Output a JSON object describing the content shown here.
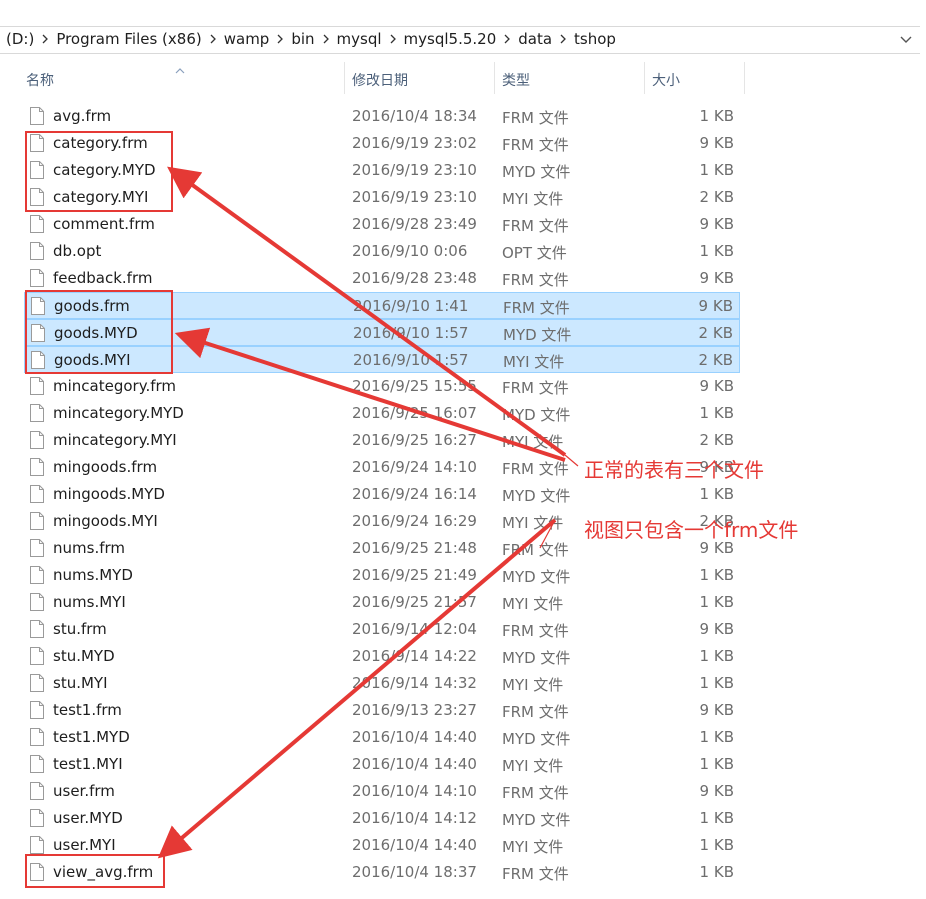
{
  "address_bar": {
    "crumbs": [
      "(D:)",
      "Program Files (x86)",
      "wamp",
      "bin",
      "mysql",
      "mysql5.5.20",
      "data",
      "tshop"
    ]
  },
  "columns": {
    "name": "名称",
    "date": "修改日期",
    "type": "类型",
    "size": "大小"
  },
  "files": [
    {
      "name": "avg.frm",
      "date": "2016/10/4 18:34",
      "type": "FRM 文件",
      "size": "1 KB",
      "selected": false
    },
    {
      "name": "category.frm",
      "date": "2016/9/19 23:02",
      "type": "FRM 文件",
      "size": "9 KB",
      "selected": false
    },
    {
      "name": "category.MYD",
      "date": "2016/9/19 23:10",
      "type": "MYD 文件",
      "size": "1 KB",
      "selected": false
    },
    {
      "name": "category.MYI",
      "date": "2016/9/19 23:10",
      "type": "MYI 文件",
      "size": "2 KB",
      "selected": false
    },
    {
      "name": "comment.frm",
      "date": "2016/9/28 23:49",
      "type": "FRM 文件",
      "size": "9 KB",
      "selected": false
    },
    {
      "name": "db.opt",
      "date": "2016/9/10 0:06",
      "type": "OPT 文件",
      "size": "1 KB",
      "selected": false
    },
    {
      "name": "feedback.frm",
      "date": "2016/9/28 23:48",
      "type": "FRM 文件",
      "size": "9 KB",
      "selected": false
    },
    {
      "name": "goods.frm",
      "date": "2016/9/10 1:41",
      "type": "FRM 文件",
      "size": "9 KB",
      "selected": true
    },
    {
      "name": "goods.MYD",
      "date": "2016/9/10 1:57",
      "type": "MYD 文件",
      "size": "2 KB",
      "selected": true
    },
    {
      "name": "goods.MYI",
      "date": "2016/9/10 1:57",
      "type": "MYI 文件",
      "size": "2 KB",
      "selected": true
    },
    {
      "name": "mincategory.frm",
      "date": "2016/9/25 15:55",
      "type": "FRM 文件",
      "size": "9 KB",
      "selected": false
    },
    {
      "name": "mincategory.MYD",
      "date": "2016/9/25 16:07",
      "type": "MYD 文件",
      "size": "1 KB",
      "selected": false
    },
    {
      "name": "mincategory.MYI",
      "date": "2016/9/25 16:27",
      "type": "MYI 文件",
      "size": "2 KB",
      "selected": false
    },
    {
      "name": "mingoods.frm",
      "date": "2016/9/24 14:10",
      "type": "FRM 文件",
      "size": "9 KB",
      "selected": false
    },
    {
      "name": "mingoods.MYD",
      "date": "2016/9/24 16:14",
      "type": "MYD 文件",
      "size": "1 KB",
      "selected": false
    },
    {
      "name": "mingoods.MYI",
      "date": "2016/9/24 16:29",
      "type": "MYI 文件",
      "size": "2 KB",
      "selected": false
    },
    {
      "name": "nums.frm",
      "date": "2016/9/25 21:48",
      "type": "FRM 文件",
      "size": "9 KB",
      "selected": false
    },
    {
      "name": "nums.MYD",
      "date": "2016/9/25 21:49",
      "type": "MYD 文件",
      "size": "1 KB",
      "selected": false
    },
    {
      "name": "nums.MYI",
      "date": "2016/9/25 21:57",
      "type": "MYI 文件",
      "size": "1 KB",
      "selected": false
    },
    {
      "name": "stu.frm",
      "date": "2016/9/14 12:04",
      "type": "FRM 文件",
      "size": "9 KB",
      "selected": false
    },
    {
      "name": "stu.MYD",
      "date": "2016/9/14 14:22",
      "type": "MYD 文件",
      "size": "1 KB",
      "selected": false
    },
    {
      "name": "stu.MYI",
      "date": "2016/9/14 14:32",
      "type": "MYI 文件",
      "size": "1 KB",
      "selected": false
    },
    {
      "name": "test1.frm",
      "date": "2016/9/13 23:27",
      "type": "FRM 文件",
      "size": "9 KB",
      "selected": false
    },
    {
      "name": "test1.MYD",
      "date": "2016/10/4 14:40",
      "type": "MYD 文件",
      "size": "1 KB",
      "selected": false
    },
    {
      "name": "test1.MYI",
      "date": "2016/10/4 14:40",
      "type": "MYI 文件",
      "size": "1 KB",
      "selected": false
    },
    {
      "name": "user.frm",
      "date": "2016/10/4 14:10",
      "type": "FRM 文件",
      "size": "9 KB",
      "selected": false
    },
    {
      "name": "user.MYD",
      "date": "2016/10/4 14:12",
      "type": "MYD 文件",
      "size": "1 KB",
      "selected": false
    },
    {
      "name": "user.MYI",
      "date": "2016/10/4 14:40",
      "type": "MYI 文件",
      "size": "1 KB",
      "selected": false
    },
    {
      "name": "view_avg.frm",
      "date": "2016/10/4 18:37",
      "type": "FRM 文件",
      "size": "1 KB",
      "selected": false
    }
  ],
  "annotations": {
    "normal_table_note": "正常的表有三个文件",
    "view_note": "视图只包含一个frm文件",
    "color": "#e53935"
  },
  "colors": {
    "selection_bg": "#cce8ff",
    "selection_border": "#99d1ff",
    "header_text": "#4c607a"
  }
}
